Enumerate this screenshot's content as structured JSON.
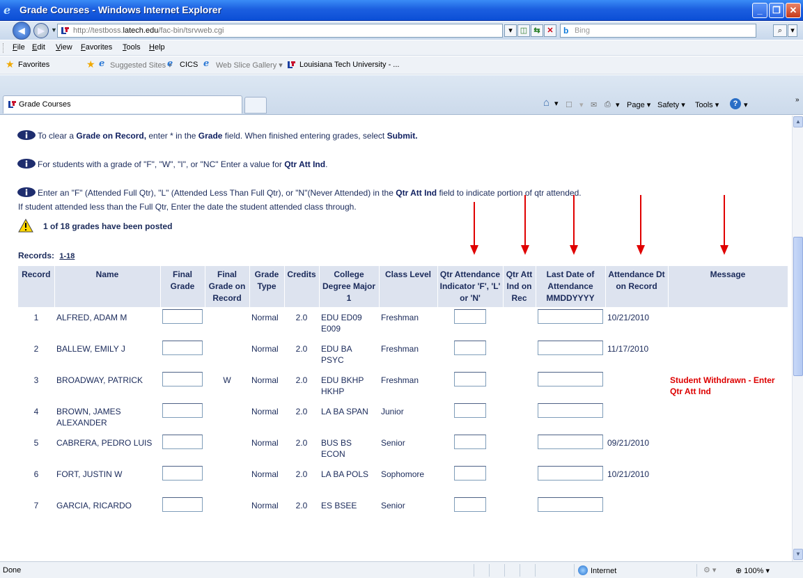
{
  "window": {
    "title": "Grade Courses - Windows Internet Explorer"
  },
  "address": {
    "url_prefix": "http://testboss.",
    "url_host": "latech.edu",
    "url_suffix": "/fac-bin/tsrvweb.cgi",
    "search_placeholder": "Bing"
  },
  "menu": [
    "File",
    "Edit",
    "View",
    "Favorites",
    "Tools",
    "Help"
  ],
  "favorites": {
    "label": "Favorites",
    "suggested": "Suggested Sites",
    "cics": "CICS",
    "webslice": "Web Slice Gallery",
    "latech": "Louisiana Tech University - ..."
  },
  "tab": {
    "label": "Grade Courses"
  },
  "commands": {
    "page": "Page",
    "safety": "Safety",
    "tools": "Tools"
  },
  "instructions": {
    "line1_a": "To clear a ",
    "line1_b": "Grade on Record,",
    "line1_c": " enter * in the ",
    "line1_d": "Grade",
    "line1_e": " field. When finished entering grades, select ",
    "line1_f": "Submit.",
    "line2_a": "For students with a grade of \"F\", \"W\", \"I\", or \"NC\" Enter a value for ",
    "line2_b": "Qtr Att Ind",
    "line2_c": ".",
    "line3_a": "Enter an \"F\" (Attended Full Qtr), \"L\" (Attended Less Than Full Qtr), or \"N\"(Never Attended) in the ",
    "line3_b": "Qtr Att Ind",
    "line3_c": " field to indicate portion of qtr attended.",
    "line4": "If student attended less than the Full Qtr, Enter the date the student attended class through."
  },
  "warning": "1 of 18 grades have been posted",
  "records": {
    "label": "Records:",
    "range": "1-18"
  },
  "table": {
    "headers": {
      "record": "Record",
      "name": "Name",
      "final_grade": "Final Grade",
      "final_grade_on_record": "Final Grade on Record",
      "grade_type": "Grade Type",
      "credits": "Credits",
      "college": "College Degree Major 1",
      "class_level": "Class Level",
      "qtr_att_indicator": "Qtr Attendance Indicator 'F', 'L' or 'N'",
      "qtr_att_ind_on_rec": "Qtr Att Ind on Rec",
      "last_date": "Last Date of Attendance MMDDYYYY",
      "attendance_dt": "Attendance Dt on Record",
      "message": "Message"
    },
    "rows": [
      {
        "record": "1",
        "name": "ALFRED, ADAM M",
        "grade_on_record": "",
        "type": "Normal",
        "credits": "2.0",
        "college": "EDU ED09 E009",
        "level": "Freshman",
        "att_ind_rec": "",
        "att_dt": "10/21/2010",
        "message": ""
      },
      {
        "record": "2",
        "name": "BALLEW, EMILY J",
        "grade_on_record": "",
        "type": "Normal",
        "credits": "2.0",
        "college": "EDU BA PSYC",
        "level": "Freshman",
        "att_ind_rec": "",
        "att_dt": "11/17/2010",
        "message": ""
      },
      {
        "record": "3",
        "name": "BROADWAY, PATRICK",
        "grade_on_record": "W",
        "type": "Normal",
        "credits": "2.0",
        "college": "EDU BKHP HKHP",
        "level": "Freshman",
        "att_ind_rec": "",
        "att_dt": "",
        "message": "Student Withdrawn - Enter Qtr Att Ind"
      },
      {
        "record": "4",
        "name": "BROWN, JAMES ALEXANDER",
        "grade_on_record": "",
        "type": "Normal",
        "credits": "2.0",
        "college": "LA BA SPAN",
        "level": "Junior",
        "att_ind_rec": "",
        "att_dt": "",
        "message": ""
      },
      {
        "record": "5",
        "name": "CABRERA, PEDRO LUIS",
        "grade_on_record": "",
        "type": "Normal",
        "credits": "2.0",
        "college": "BUS BS ECON",
        "level": "Senior",
        "att_ind_rec": "",
        "att_dt": "09/21/2010",
        "message": ""
      },
      {
        "record": "6",
        "name": "FORT, JUSTIN W",
        "grade_on_record": "",
        "type": "Normal",
        "credits": "2.0",
        "college": "LA BA POLS",
        "level": "Sophomore",
        "att_ind_rec": "",
        "att_dt": "10/21/2010",
        "message": ""
      },
      {
        "record": "7",
        "name": "GARCIA, RICARDO",
        "grade_on_record": "",
        "type": "Normal",
        "credits": "2.0",
        "college": "ES BSEE",
        "level": "Senior",
        "att_ind_rec": "",
        "att_dt": "",
        "message": ""
      }
    ]
  },
  "status": {
    "done": "Done",
    "zone": "Internet",
    "zoom": "100%"
  },
  "colors": {
    "header_bg": "#dde3ef",
    "text_navy": "#1a2a5a",
    "message_red": "#dd0000",
    "arrow_red": "#e00000"
  }
}
